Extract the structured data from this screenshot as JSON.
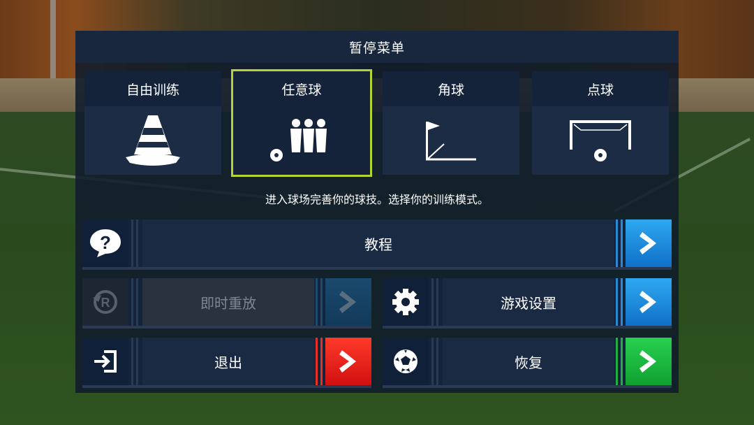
{
  "title": "暂停菜单",
  "modes": [
    {
      "label": "自由训练",
      "icon": "cone-icon"
    },
    {
      "label": "任意球",
      "icon": "free-kick-wall-icon",
      "selected": true
    },
    {
      "label": "角球",
      "icon": "corner-flag-icon"
    },
    {
      "label": "点球",
      "icon": "penalty-goal-icon"
    }
  ],
  "hint": "进入球场完善你的球技。选择你的训练模式。",
  "buttons": {
    "tutorial": {
      "label": "教程",
      "icon": "question-bubble-icon",
      "accent": "#2aa0ea"
    },
    "replay": {
      "label": "即时重放",
      "icon": "replay-icon",
      "enabled": false
    },
    "settings": {
      "label": "游戏设置",
      "icon": "gear-icon",
      "accent": "#2aa0ea"
    },
    "quit": {
      "label": "退出",
      "icon": "exit-icon",
      "accent": "#f02a20"
    },
    "resume": {
      "label": "恢复",
      "icon": "soccer-ball-icon",
      "accent": "#20c048"
    }
  }
}
